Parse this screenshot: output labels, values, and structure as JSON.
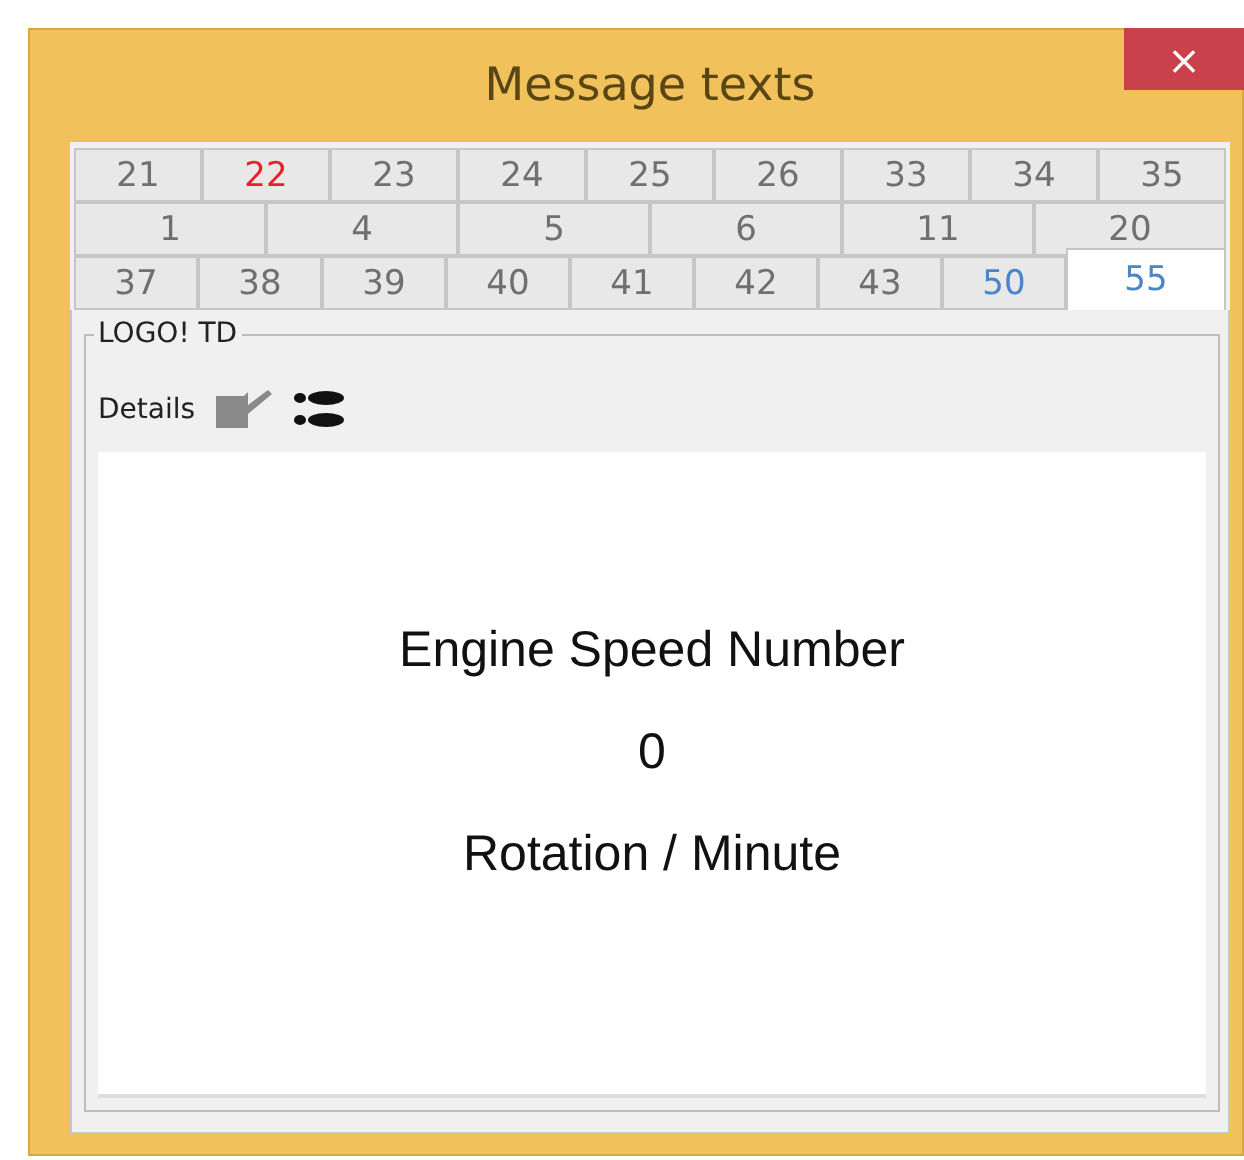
{
  "window": {
    "title": "Message texts",
    "close": "×"
  },
  "tab_rows": [
    {
      "tabs": [
        {
          "label": "21",
          "selected": false,
          "color": "#707070"
        },
        {
          "label": "22",
          "selected": false,
          "color": "#e8202a"
        },
        {
          "label": "23",
          "selected": false,
          "color": "#707070"
        },
        {
          "label": "24",
          "selected": false,
          "color": "#707070"
        },
        {
          "label": "25",
          "selected": false,
          "color": "#707070"
        },
        {
          "label": "26",
          "selected": false,
          "color": "#707070"
        },
        {
          "label": "33",
          "selected": false,
          "color": "#707070"
        },
        {
          "label": "34",
          "selected": false,
          "color": "#707070"
        },
        {
          "label": "35",
          "selected": false,
          "color": "#707070"
        }
      ]
    },
    {
      "tabs": [
        {
          "label": "1",
          "selected": false,
          "color": "#707070"
        },
        {
          "label": "4",
          "selected": false,
          "color": "#707070"
        },
        {
          "label": "5",
          "selected": false,
          "color": "#707070"
        },
        {
          "label": "6",
          "selected": false,
          "color": "#707070"
        },
        {
          "label": "11",
          "selected": false,
          "color": "#707070"
        },
        {
          "label": "20",
          "selected": false,
          "color": "#707070"
        }
      ]
    },
    {
      "tabs": [
        {
          "label": "37",
          "selected": false,
          "color": "#707070"
        },
        {
          "label": "38",
          "selected": false,
          "color": "#707070"
        },
        {
          "label": "39",
          "selected": false,
          "color": "#707070"
        },
        {
          "label": "40",
          "selected": false,
          "color": "#707070"
        },
        {
          "label": "41",
          "selected": false,
          "color": "#707070"
        },
        {
          "label": "42",
          "selected": false,
          "color": "#707070"
        },
        {
          "label": "43",
          "selected": false,
          "color": "#707070"
        },
        {
          "label": "50",
          "selected": false,
          "color": "#4a86c8"
        },
        {
          "label": "55",
          "selected": true,
          "color": "#4a86c8"
        }
      ]
    }
  ],
  "group": {
    "title": "LOGO! TD",
    "details_label": "Details"
  },
  "display": {
    "lines": [
      "Engine Speed Number",
      "0",
      "Rotation / Minute"
    ]
  }
}
